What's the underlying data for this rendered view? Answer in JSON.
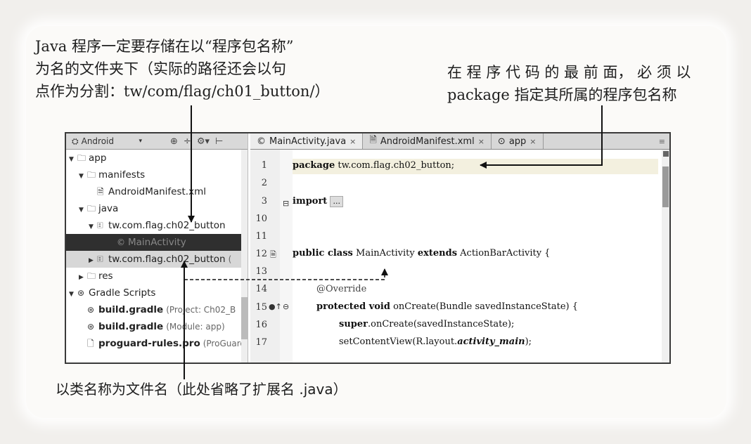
{
  "annotations": {
    "left_lines": [
      "Java 程序一定要存储在以“程序包名称”",
      "为名的文件夹下（实际的路径还会以句",
      "点作为分割：tw/com/flag/ch01_button/）"
    ],
    "right_lines": [
      "在 程 序 代 码 的 最 前 面， 必 须 以",
      "package 指定其所属的程序包名称"
    ],
    "bottom": "以类名称为文件名（此处省略了扩展名 .java）"
  },
  "project_panel": {
    "view_selector": "Android",
    "tree": [
      {
        "arrow": "▼",
        "icon": "folder-icon",
        "glyph": "🗀",
        "label": "app",
        "sub": ""
      },
      {
        "arrow": "▼",
        "icon": "folder-icon",
        "glyph": "🗀",
        "label": "manifests",
        "sub": ""
      },
      {
        "arrow": "",
        "icon": "xml-file-icon",
        "glyph": "🗎",
        "label": "AndroidManifest.xml",
        "sub": ""
      },
      {
        "arrow": "▼",
        "icon": "folder-icon",
        "glyph": "🗀",
        "label": "java",
        "sub": ""
      },
      {
        "arrow": "▼",
        "icon": "package-icon",
        "glyph": "🗉",
        "label": "tw.com.flag.ch02_button",
        "sub": ""
      },
      {
        "arrow": "",
        "icon": "class-icon",
        "glyph": "©",
        "label": "MainActivity",
        "sub": ""
      },
      {
        "arrow": "▶",
        "icon": "package-icon",
        "glyph": "🗉",
        "label": "tw.com.flag.ch02_button",
        "sub": "("
      },
      {
        "arrow": "▶",
        "icon": "folder-icon",
        "glyph": "🗀",
        "label": "res",
        "sub": ""
      },
      {
        "arrow": "▼",
        "icon": "gradle-icon",
        "glyph": "⊛",
        "label": "Gradle Scripts",
        "sub": ""
      },
      {
        "arrow": "",
        "icon": "gradle-icon",
        "glyph": "⊛",
        "label": "build.gradle",
        "sub": "(Project: Ch02_B"
      },
      {
        "arrow": "",
        "icon": "gradle-icon",
        "glyph": "⊛",
        "label": "build.gradle",
        "sub": "(Module: app)"
      },
      {
        "arrow": "",
        "icon": "file-icon",
        "glyph": "🗋",
        "label": "proguard-rules.pro",
        "sub": "(ProGuard"
      }
    ]
  },
  "tabs": [
    {
      "label": "MainActivity.java",
      "icon": "class-icon",
      "glyph": "©"
    },
    {
      "label": "AndroidManifest.xml",
      "icon": "xml-file-icon",
      "glyph": "🗎"
    },
    {
      "label": "app",
      "icon": "module-icon",
      "glyph": "⊙"
    }
  ],
  "tabs_more": "≡",
  "line_numbers": [
    "1",
    "2",
    "3",
    "10",
    "11",
    "12",
    "13",
    "14",
    "15",
    "16",
    "17"
  ],
  "code": {
    "l1_kw": "package",
    "l1_rest": " tw.com.flag.ch02_button;",
    "l3_kw": "import",
    "l3_fold": "...",
    "l12_kw": "public class",
    "l12_name": " MainActivity ",
    "l12_kw2": "extends",
    "l12_rest": " ActionBarActivity {",
    "l14": "@Override",
    "l15_kw": "protected void",
    "l15_rest": " onCreate(Bundle savedInstanceState) {",
    "l16_kw": "super",
    "l16_rest": ".onCreate(savedInstanceState);",
    "l17_a": "setContentView(R.layout.",
    "l17_b": "activity_main",
    "l17_c": ");"
  }
}
